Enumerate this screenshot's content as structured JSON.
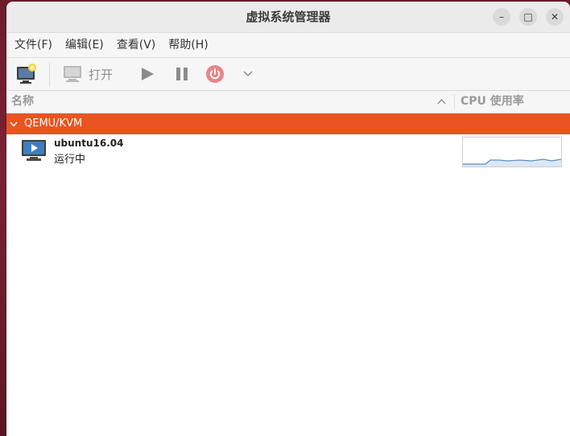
{
  "window": {
    "title": "虚拟系统管理器"
  },
  "titlebar_buttons": {
    "minimize": "–",
    "maximize": "□",
    "close": "✕"
  },
  "menu": [
    "文件(F)",
    "编辑(E)",
    "查看(V)",
    "帮助(H)"
  ],
  "toolbar": {
    "open_label": "打开"
  },
  "columns": {
    "name": "名称",
    "cpu": "CPU 使用率"
  },
  "group": {
    "name": "QEMU/KVM"
  },
  "vm": {
    "name": "ubuntu16.04",
    "status": "运行中"
  },
  "icons": {
    "new_vm": "new-vm-icon",
    "monitor": "monitor-icon",
    "run": "play-icon",
    "pause": "pause-icon",
    "power": "power-icon",
    "more": "chevron-down-icon"
  },
  "colors": {
    "accent": "#e95420",
    "graph_line": "#5b8fbf"
  }
}
